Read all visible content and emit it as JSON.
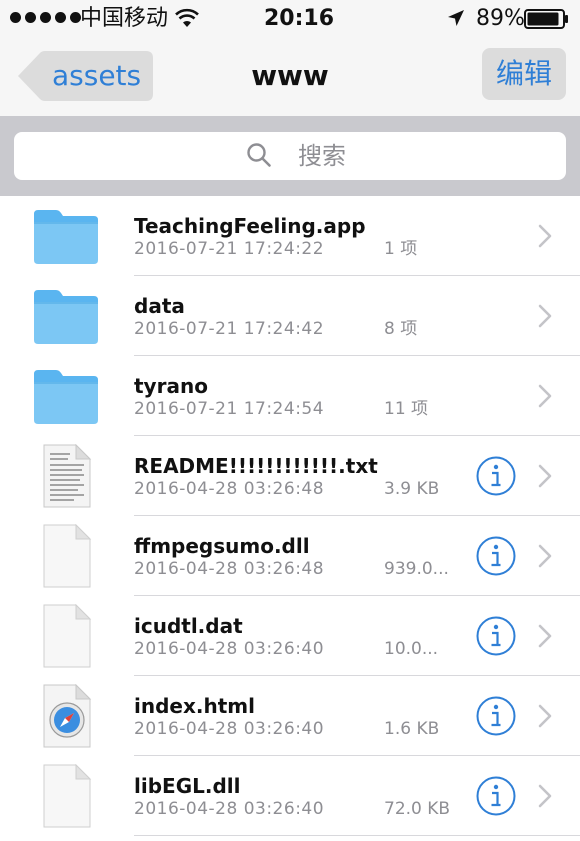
{
  "status_bar": {
    "carrier": "中国移动",
    "time": "20:16",
    "battery": "89%",
    "battery_level": 0.89
  },
  "nav": {
    "back_label": "assets",
    "title": "www",
    "edit_label": "编辑"
  },
  "search": {
    "placeholder": "搜索"
  },
  "colors": {
    "accent": "#2f7fd6",
    "folder": "#5ab5f0",
    "secondary_text": "#8e8e93"
  },
  "files": [
    {
      "name": "TeachingFeeling.app",
      "date": "2016-07-21 17:24:22",
      "size": "1 项",
      "icon": "folder-icon",
      "info": false
    },
    {
      "name": "data",
      "date": "2016-07-21 17:24:42",
      "size": "8 项",
      "icon": "folder-icon",
      "info": false
    },
    {
      "name": "tyrano",
      "date": "2016-07-21 17:24:54",
      "size": "11 项",
      "icon": "folder-icon",
      "info": false
    },
    {
      "name": "README!!!!!!!!!!!!.txt",
      "date": "2016-04-28 03:26:48",
      "size": "3.9 KB",
      "icon": "text-file-icon",
      "info": true
    },
    {
      "name": "ffmpegsumo.dll",
      "date": "2016-04-28 03:26:48",
      "size": "939.0...",
      "icon": "blank-file-icon",
      "info": true
    },
    {
      "name": "icudtl.dat",
      "date": "2016-04-28 03:26:40",
      "size": "10.0...",
      "icon": "blank-file-icon",
      "info": true
    },
    {
      "name": "index.html",
      "date": "2016-04-28 03:26:40",
      "size": "1.6 KB",
      "icon": "safari-file-icon",
      "info": true
    },
    {
      "name": "libEGL.dll",
      "date": "2016-04-28 03:26:40",
      "size": "72.0 KB",
      "icon": "blank-file-icon",
      "info": true
    }
  ]
}
